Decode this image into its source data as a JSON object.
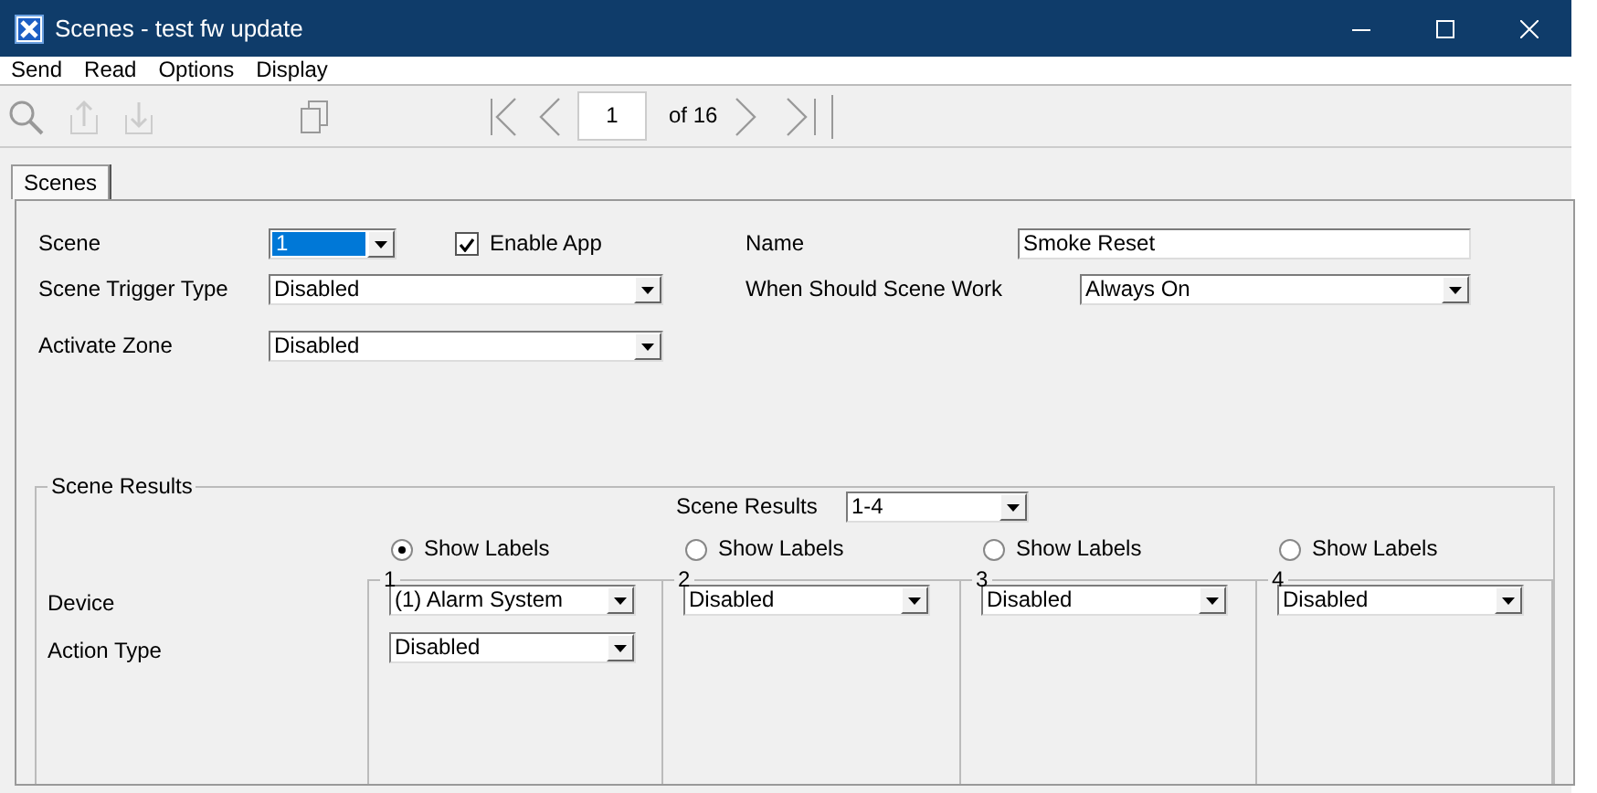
{
  "window": {
    "title": "Scenes - test fw update"
  },
  "menu": [
    "Send",
    "Read",
    "Options",
    "Display"
  ],
  "toolbar": {
    "page": "1",
    "page_count": "of 16"
  },
  "tabs": [
    {
      "label": "Scenes",
      "selected": true
    }
  ],
  "form": {
    "scene": {
      "label": "Scene",
      "value": "1"
    },
    "enable_app": {
      "label": "Enable App",
      "checked": true
    },
    "name": {
      "label": "Name",
      "value": "Smoke Reset"
    },
    "trigger": {
      "label": "Scene Trigger Type",
      "value": "Disabled"
    },
    "when": {
      "label": "When Should Scene Work",
      "value": "Always On"
    },
    "zone": {
      "label": "Activate Zone",
      "value": "Disabled"
    }
  },
  "scene_results": {
    "title": "Scene Results",
    "range": {
      "label": "Scene Results",
      "value": "1-4"
    },
    "row_labels": [
      "Device",
      "Action Type"
    ],
    "slots": [
      {
        "number": "1",
        "show_labels": {
          "label": "Show Labels",
          "selected": true
        },
        "device": "(1) Alarm System",
        "action_type": "Disabled"
      },
      {
        "number": "2",
        "show_labels": {
          "label": "Show Labels",
          "selected": false
        },
        "device": "Disabled"
      },
      {
        "number": "3",
        "show_labels": {
          "label": "Show Labels",
          "selected": false
        },
        "device": "Disabled"
      },
      {
        "number": "4",
        "show_labels": {
          "label": "Show Labels",
          "selected": false
        },
        "device": "Disabled"
      }
    ]
  }
}
